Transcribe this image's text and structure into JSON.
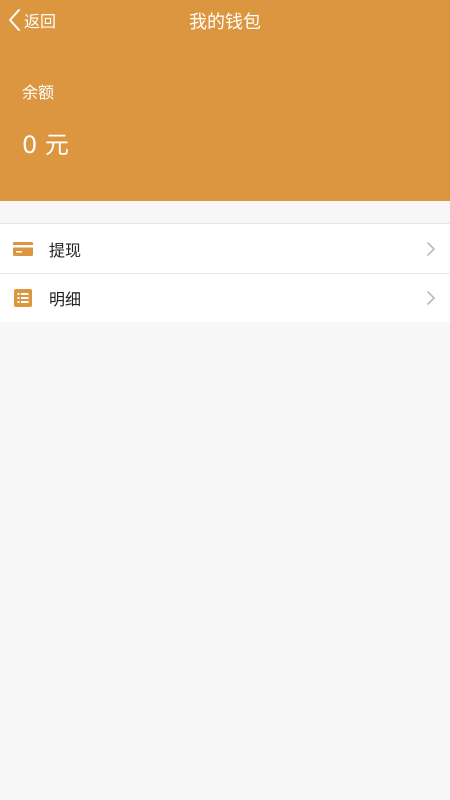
{
  "nav": {
    "back_label": "返回",
    "title": "我的钱包"
  },
  "balance": {
    "label": "余额",
    "value": "0 元"
  },
  "menu": {
    "items": [
      {
        "label": "提现",
        "icon": "card-icon"
      },
      {
        "label": "明细",
        "icon": "list-icon"
      }
    ]
  },
  "colors": {
    "accent": "#dc963f",
    "background": "#f7f7f7",
    "text": "#222222",
    "chevron": "#bbbbbb"
  }
}
